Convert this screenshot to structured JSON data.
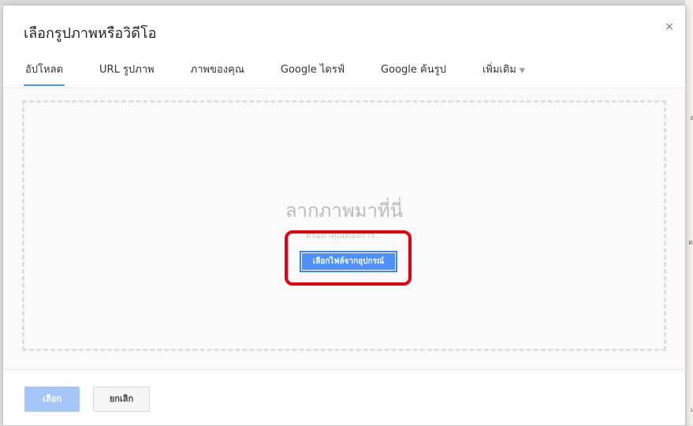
{
  "dialog": {
    "title": "เลือกรูปภาพหรือวิดีโอ",
    "close_icon": "×"
  },
  "tabs": [
    {
      "label": "อัปโหลด",
      "active": true
    },
    {
      "label": "URL รูปภาพ",
      "active": false
    },
    {
      "label": "ภาพของคุณ",
      "active": false
    },
    {
      "label": "Google ไดรฟ์",
      "active": false
    },
    {
      "label": "Google ค้นรูป",
      "active": false
    },
    {
      "label": "เพิ่มเติม",
      "active": false,
      "caret": "▼"
    }
  ],
  "upload": {
    "drop_label": "ลากภาพมาที่นี่",
    "or_label": "หรือถ้าคุณต้องการ...",
    "choose_file_label": "เลือกไฟล์จากอุปกรณ์"
  },
  "footer": {
    "select_label": "เลือก",
    "cancel_label": "ยกเลิก"
  },
  "colors": {
    "accent": "#4d90fe",
    "highlight": "#e8000b",
    "select_disabled": "#a6c5f9"
  },
  "background": {
    "side_fragments": [
      "ง",
      "ต",
      "เ"
    ]
  }
}
